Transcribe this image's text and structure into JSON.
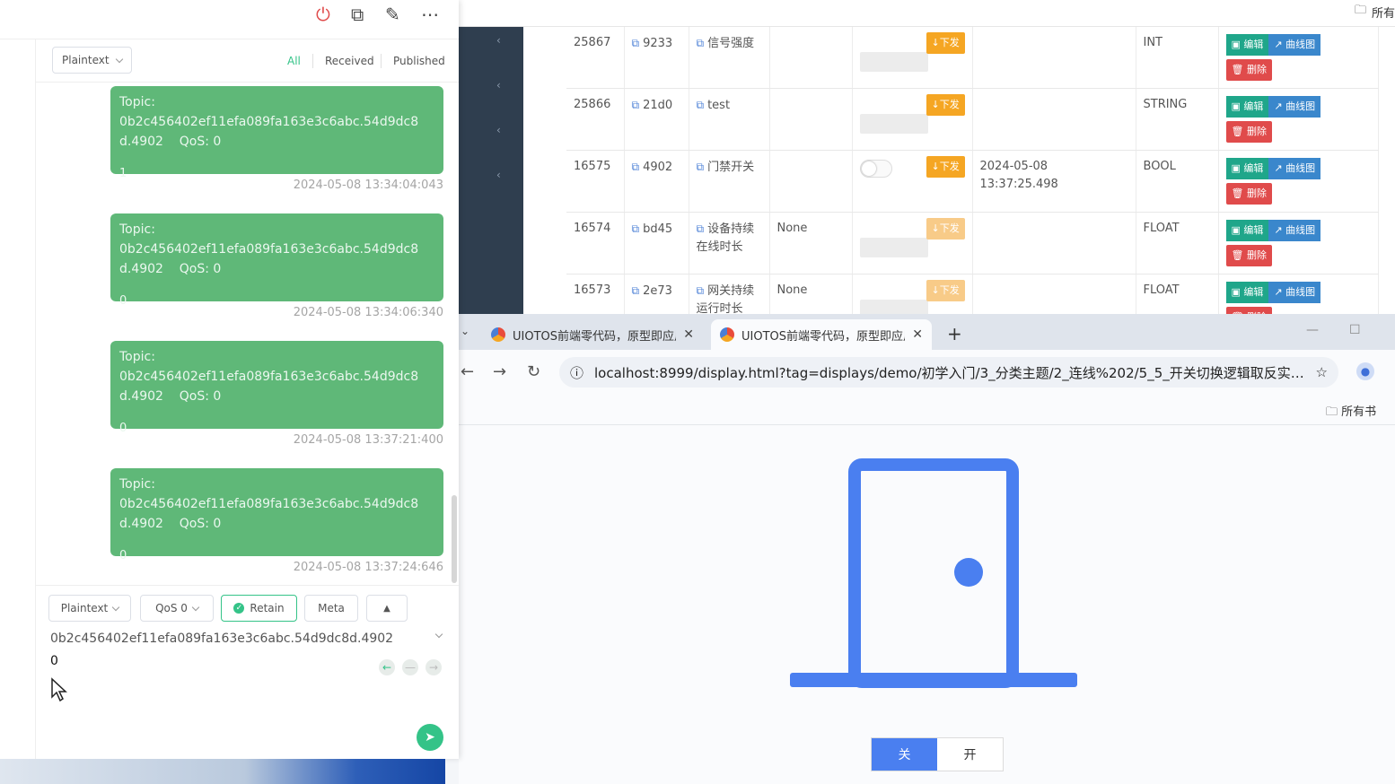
{
  "admin": {
    "bookmarks_label": "所有",
    "rows": [
      {
        "id": "25867",
        "key": "9233",
        "name": "信号强度",
        "value": "",
        "control": "none",
        "down": "↓下发",
        "time": "",
        "type": "INT"
      },
      {
        "id": "25866",
        "key": "21d0",
        "name": "test",
        "value": "",
        "control": "none",
        "down": "↓下发",
        "time": "",
        "type": "STRING"
      },
      {
        "id": "16575",
        "key": "4902",
        "name": "门禁开关",
        "value": "",
        "control": "switch",
        "down": "↓下发",
        "time": "2024-05-08 13:37:25.498",
        "type": "BOOL"
      },
      {
        "id": "16574",
        "key": "bd45",
        "name": "设备持续在线时长",
        "value": "None",
        "control": "none",
        "down": "↓下发",
        "time": "",
        "type": "FLOAT"
      },
      {
        "id": "16573",
        "key": "2e73",
        "name": "网关持续运行时长",
        "value": "None",
        "control": "none",
        "down": "↓下发",
        "time": "",
        "type": "FLOAT"
      }
    ],
    "edit_label": "编辑",
    "chart_label": "曲线图",
    "delete_label": "删除"
  },
  "browser": {
    "tabs": [
      {
        "title": "UIOTOS前端零代码，原型即应用",
        "active": false
      },
      {
        "title": "UIOTOS前端零代码，原型即应用",
        "active": true
      }
    ],
    "url": "localhost:8999/display.html?tag=displays/demo/初学入门/3_分类主题/2_连线%202/5_5_开关切换逻辑取反实现...",
    "bookmarks_label": "所有书",
    "toggle": {
      "off_label": "关",
      "on_label": "开",
      "selected": "关"
    },
    "accent": "#4a7ff0"
  },
  "mqtt": {
    "header_icons": [
      "power-icon",
      "windows-icon",
      "edit-icon",
      "more-icon"
    ],
    "format": "Plaintext",
    "filters": [
      "All",
      "Received",
      "Published"
    ],
    "active_filter": "All",
    "messages": [
      {
        "topic": "Topic: 0b2c456402ef11efa089fa163e3c6abc.54d9dc8",
        "topic2": "d.4902",
        "qos": "QoS: 0",
        "payload": "1",
        "time": "2024-05-08 13:34:04:043"
      },
      {
        "topic": "Topic: 0b2c456402ef11efa089fa163e3c6abc.54d9dc8",
        "topic2": "d.4902",
        "qos": "QoS: 0",
        "payload": "0",
        "time": "2024-05-08 13:34:06:340"
      },
      {
        "topic": "Topic: 0b2c456402ef11efa089fa163e3c6abc.54d9dc8",
        "topic2": "d.4902",
        "qos": "QoS: 0",
        "payload": "0",
        "time": "2024-05-08 13:37:21:400"
      },
      {
        "topic": "Topic: 0b2c456402ef11efa089fa163e3c6abc.54d9dc8",
        "topic2": "d.4902",
        "qos": "QoS: 0",
        "payload": "0",
        "time": "2024-05-08 13:37:24:646"
      }
    ],
    "composer": {
      "format": "Plaintext",
      "qos": "QoS 0",
      "retain": "Retain",
      "meta": "Meta",
      "topic": "0b2c456402ef11efa089fa163e3c6abc.54d9dc8d.4902",
      "payload": "0"
    },
    "message_color": "#5fb878",
    "accent": "#34c388"
  }
}
